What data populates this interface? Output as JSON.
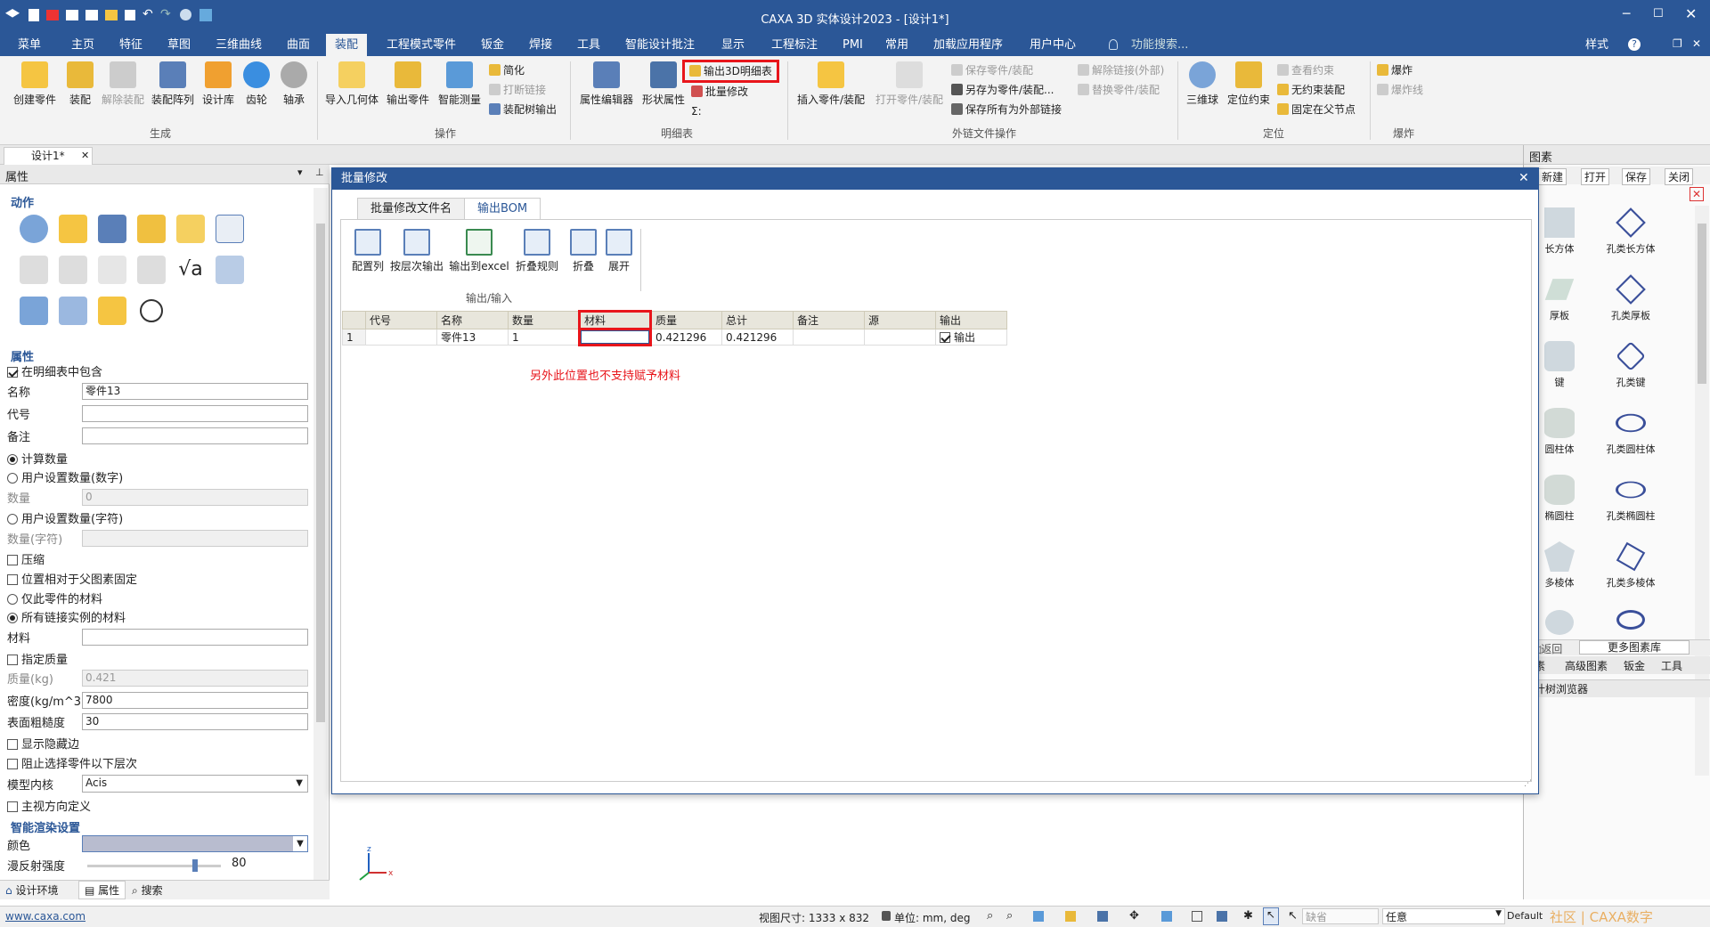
{
  "title": "CAXA 3D 实体设计2023 - [设计1*]",
  "menu": [
    "菜单",
    "主页",
    "特征",
    "草图",
    "三维曲线",
    "曲面",
    "装配",
    "工程模式零件",
    "钣金",
    "焊接",
    "工具",
    "智能设计批注",
    "显示",
    "工程标注",
    "PMI",
    "常用",
    "加载应用程序",
    "用户中心"
  ],
  "menu_search": "功能搜索...",
  "menu_right": "样式",
  "ribbon": {
    "gen": [
      "创建零件",
      "装配",
      "解除装配",
      "装配阵列",
      "设计库",
      "齿轮",
      "轴承"
    ],
    "gen_label": "生成",
    "op": [
      "导入几何体",
      "输出零件",
      "智能测量"
    ],
    "op_small": [
      "简化",
      "打断链接",
      "装配树输出"
    ],
    "op_label": "操作",
    "bom": [
      "属性编辑器",
      "形状属性"
    ],
    "bom_small": [
      "输出3D明细表",
      "批量修改",
      "Σ:"
    ],
    "bom_label": "明细表",
    "ext": [
      "插入零件/装配",
      "打开零件/装配"
    ],
    "ext_small": [
      "保存零件/装配",
      "另存为零件/装配...",
      "保存所有为外部链接",
      "解除链接(外部)",
      "替换零件/装配"
    ],
    "ext_label": "外链文件操作",
    "pos": [
      "三维球",
      "定位约束"
    ],
    "pos_small": [
      "查看约束",
      "无约束装配",
      "固定在父节点"
    ],
    "pos_label": "定位",
    "exp_small": [
      "爆炸",
      "爆炸线"
    ],
    "exp_label": "爆炸"
  },
  "doc_tab": "设计1*",
  "left": {
    "title": "属性",
    "sec_action": "动作",
    "sec_prop": "属性",
    "include_bom": "在明细表中包含",
    "name_label": "名称",
    "name_value": "零件13",
    "code_label": "代号",
    "note_label": "备注",
    "calc_qty": "计算数量",
    "user_qty_num": "用户设置数量(数字)",
    "qty_label": "数量",
    "qty_value": "0",
    "user_qty_char": "用户设置数量(字符)",
    "qty_char_label": "数量(字符)",
    "compress": "压缩",
    "pos_fixed": "位置相对于父图素固定",
    "only_mat": "仅此零件的材料",
    "all_mat": "所有链接实例的材料",
    "mat_label": "材料",
    "spec_mass": "指定质量",
    "mass_label": "质量(kg)",
    "mass_value": "0.421",
    "density_label": "密度(kg/m^3)",
    "density_value": "7800",
    "rough_label": "表面粗糙度",
    "rough_value": "30",
    "show_hidden": "显示隐藏边",
    "block_sel": "阻止选择零件以下层次",
    "kernel_label": "模型内核",
    "kernel_value": "Acis",
    "main_view": "主视方向定义",
    "sec_render": "智能渲染设置",
    "color_label": "颜色",
    "diffuse_label": "漫反射强度",
    "diffuse_value": "80",
    "bottom_tabs": [
      "设计环境",
      "属性",
      "搜索"
    ]
  },
  "right": {
    "title": "图素",
    "buttons": [
      "新建",
      "打开",
      "保存",
      "关闭"
    ],
    "items": [
      "长方体",
      "孔类长方体",
      "厚板",
      "孔类厚板",
      "键",
      "孔类键",
      "圆柱体",
      "孔类圆柱体",
      "椭圆柱",
      "孔类椭圆柱",
      "多棱体",
      "孔类多棱体"
    ],
    "back": "返回",
    "more": "更多图素库",
    "tabs": [
      "图素",
      "高级图素",
      "钣金",
      "工具"
    ],
    "browser": "设计树浏览器"
  },
  "dialog": {
    "title": "批量修改",
    "tabs": [
      "批量修改文件名",
      "输出BOM"
    ],
    "buttons": [
      "配置列",
      "按层次输出",
      "输出到excel",
      "折叠规则",
      "折叠",
      "展开"
    ],
    "group_label": "输出/输入",
    "headers": [
      "代号",
      "名称",
      "数量",
      "材料",
      "质量",
      "总计",
      "备注",
      "源",
      "输出"
    ],
    "row": {
      "idx": "1",
      "code": "",
      "name": "零件13",
      "qty": "1",
      "material": "",
      "mass": "0.421296",
      "total": "0.421296",
      "note": "",
      "src": "",
      "output": "输出"
    },
    "annotation": "另外此位置也不支持赋予材料"
  },
  "status": {
    "url": "www.caxa.com",
    "view_size": "视图尺寸: 1333 x 832",
    "unit": "单位:  mm, deg",
    "default": "缺省",
    "any": "任意",
    "watermark": "社区 | CAXA数字",
    "style": "Default"
  },
  "colors": {
    "accent": "#2b5797",
    "highlight": "#e8151b"
  }
}
